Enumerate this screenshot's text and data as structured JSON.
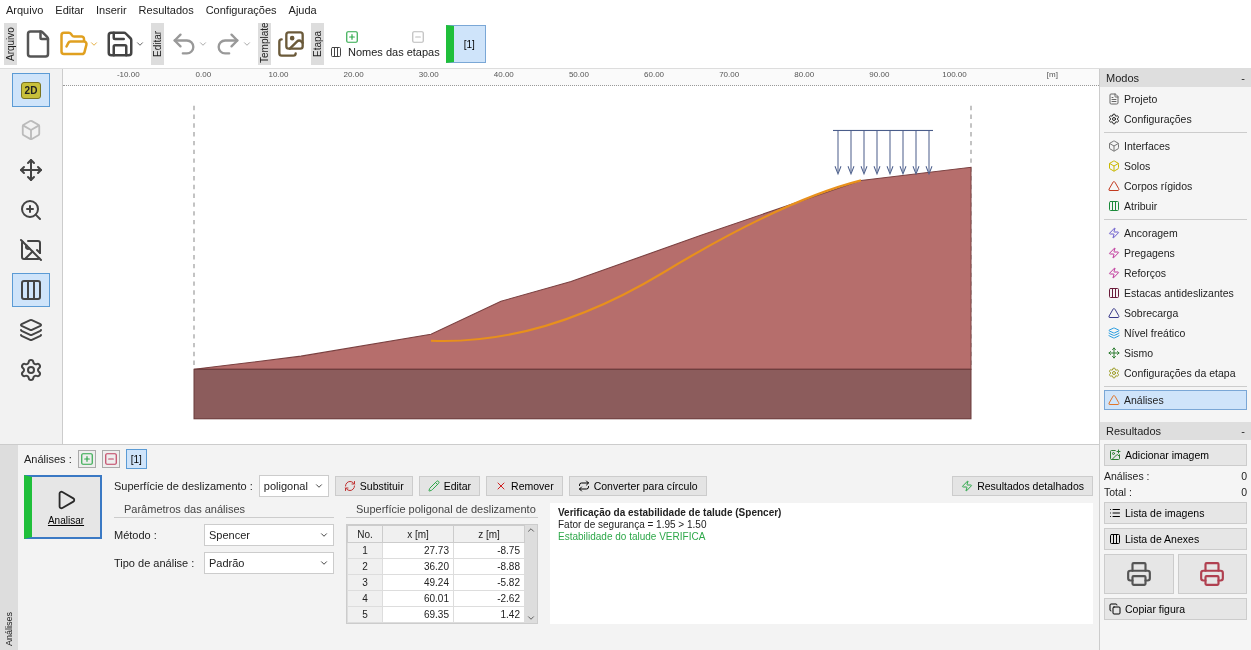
{
  "menu": [
    "Arquivo",
    "Editar",
    "Inserir",
    "Resultados",
    "Configurações",
    "Ajuda"
  ],
  "toolbar": {
    "section_labels": [
      "Arquivo",
      "Editar",
      "Template",
      "Etapa"
    ],
    "stage_names_label": "Nomes das etapas",
    "stages": [
      {
        "label": "[1]",
        "selected": true
      }
    ]
  },
  "left_tools": [
    {
      "kind": "flat",
      "label": "2D",
      "selected": true,
      "disabled": false
    },
    {
      "kind": "cube",
      "selected": false,
      "disabled": true
    },
    {
      "kind": "move",
      "selected": false,
      "disabled": false
    },
    {
      "kind": "zoom",
      "selected": false,
      "disabled": false
    },
    {
      "kind": "frame",
      "selected": false,
      "disabled": false
    },
    {
      "kind": "table",
      "selected": true,
      "disabled": false
    },
    {
      "kind": "layers",
      "selected": false,
      "disabled": false
    },
    {
      "kind": "gear",
      "selected": false,
      "disabled": false
    }
  ],
  "ruler": {
    "ticks": [
      "-10.00",
      "0.00",
      "10.00",
      "20.00",
      "30.00",
      "40.00",
      "50.00",
      "60.00",
      "70.00",
      "80.00",
      "90.00",
      "100.00"
    ],
    "unit": "[m]"
  },
  "modes": {
    "title": "Modos",
    "collapse": "-",
    "groups": [
      [
        {
          "label": "Projeto",
          "selected": false
        },
        {
          "label": "Configurações",
          "selected": false
        }
      ],
      [
        {
          "label": "Interfaces",
          "selected": false
        },
        {
          "label": "Solos",
          "selected": false
        },
        {
          "label": "Corpos rígidos",
          "selected": false
        },
        {
          "label": "Atribuir",
          "selected": false
        }
      ],
      [
        {
          "label": "Ancoragem",
          "selected": false
        },
        {
          "label": "Pregagens",
          "selected": false
        },
        {
          "label": "Reforços",
          "selected": false
        },
        {
          "label": "Estacas antideslizantes",
          "selected": false
        },
        {
          "label": "Sobrecarga",
          "selected": false
        },
        {
          "label": "Nível freático",
          "selected": false
        },
        {
          "label": "Sismo",
          "selected": false
        },
        {
          "label": "Configurações da etapa",
          "selected": false
        }
      ],
      [
        {
          "label": "Análises",
          "selected": true
        }
      ]
    ]
  },
  "results_panel": {
    "title": "Resultados",
    "collapse": "-",
    "add_image": "Adicionar imagem",
    "counts": [
      {
        "label": "Análises :",
        "value": "0"
      },
      {
        "label": "Total :",
        "value": "0"
      }
    ],
    "image_list": "Lista de imagens",
    "annex_list": "Lista de Anexes",
    "copy_figure": "Copiar figura"
  },
  "bottom": {
    "side_tab": "Análises",
    "analyses_label": "Análises :",
    "analyses": [
      {
        "label": "[1]",
        "selected": true
      }
    ],
    "analyse_button": "Analisar",
    "surface_label": "Superfície de deslizamento :",
    "surface_type": "poligonal",
    "buttons": [
      "Substituir",
      "Editar",
      "Remover",
      "Converter para círculo"
    ],
    "detailed_results": "Resultados detalhados",
    "params": {
      "title": "Parâmetros das análises",
      "fields": [
        {
          "label": "Método :",
          "value": "Spencer"
        },
        {
          "label": "Tipo de análise :",
          "value": "Padrão"
        }
      ]
    },
    "table": {
      "title": "Superfície poligonal de deslizamento",
      "columns": [
        "No.",
        "x [m]",
        "z [m]"
      ],
      "rows": [
        [
          "1",
          "27.73",
          "-8.75"
        ],
        [
          "2",
          "36.20",
          "-8.88"
        ],
        [
          "3",
          "49.24",
          "-5.82"
        ],
        [
          "4",
          "60.01",
          "-2.62"
        ],
        [
          "5",
          "69.35",
          "1.42"
        ]
      ]
    },
    "result": {
      "title": "Verificação da estabilidade de talude (Spencer)",
      "factor": "Fator de segurança = 1.95 > 1.50",
      "verdict": "Estabilidade do talude VERIFICA"
    }
  }
}
